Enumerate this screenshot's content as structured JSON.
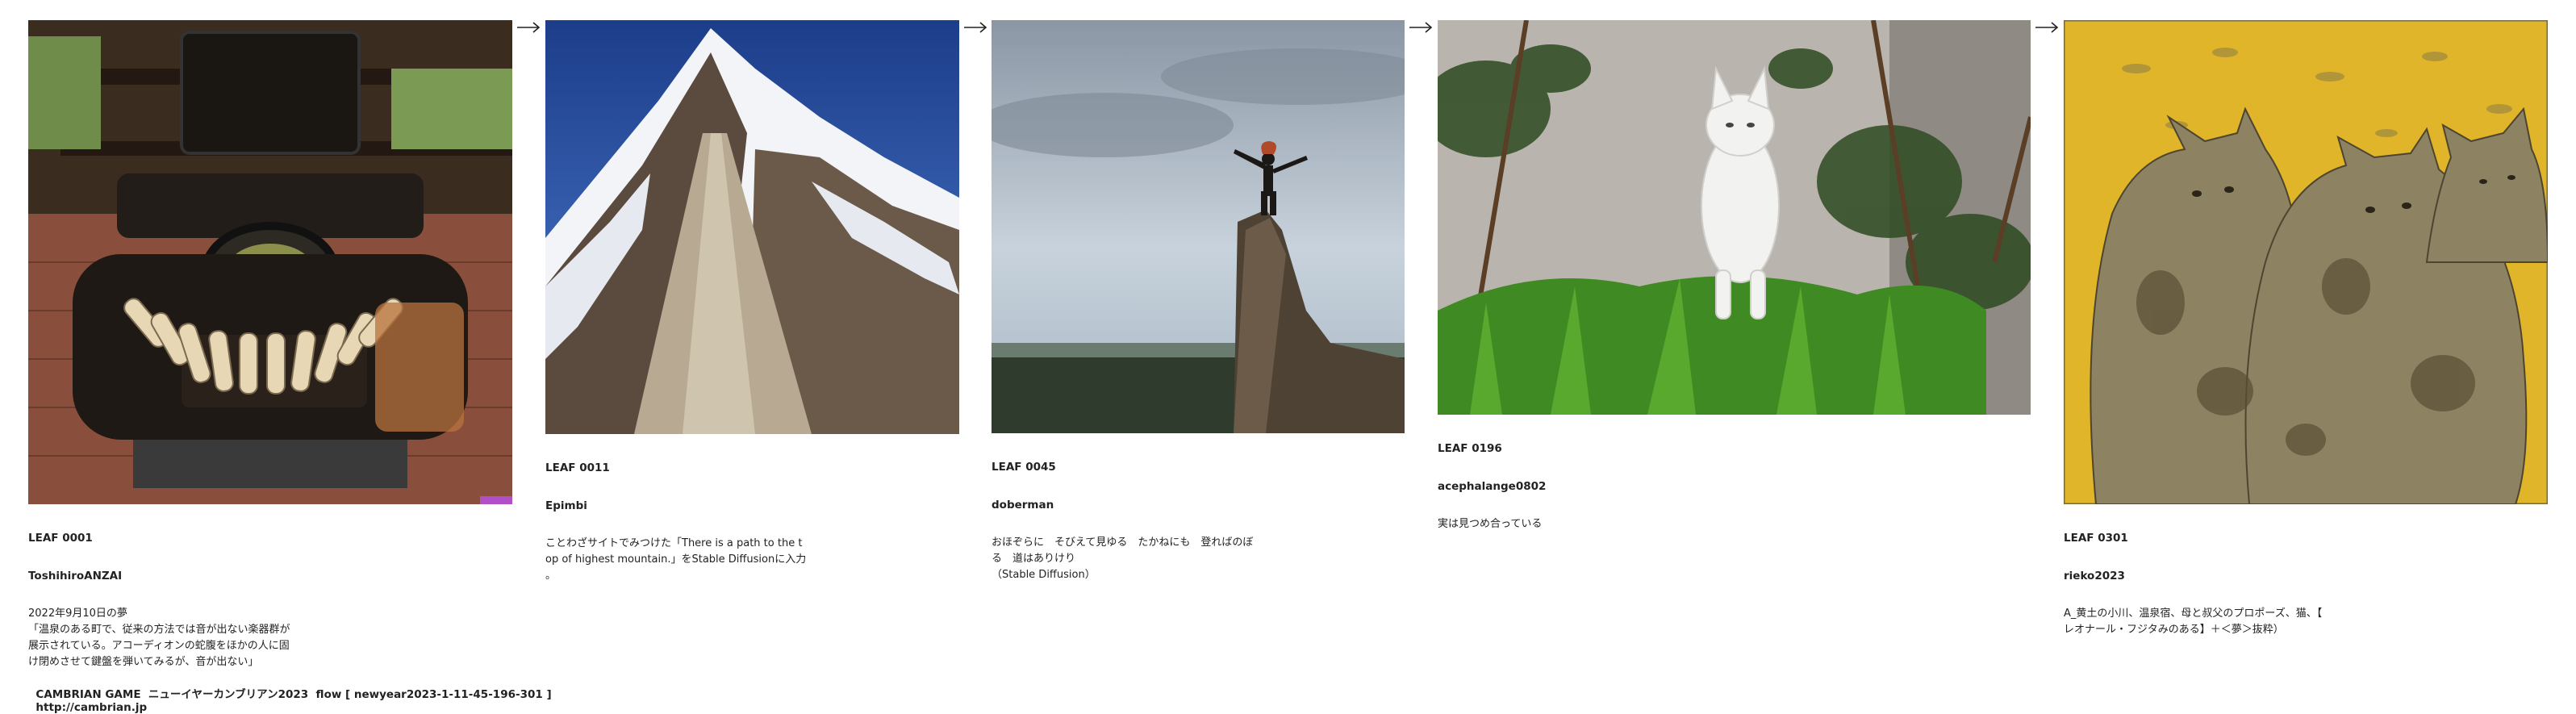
{
  "leaves": [
    {
      "code": "LEAF 0001",
      "author": "ToshihiroANZAI",
      "desc": "2022年9月10日の夢\n「温泉のある町で、従来の方法では音が出ない楽器群が\n展示されている。アコーディオンの蛇腹をほかの人に固\nけ閉めさせて鍵盤を弾いてみるが、音が出ない」"
    },
    {
      "code": "LEAF 0011",
      "author": "Epimbi",
      "desc": "ことわざサイトでみつけた「There is a path to the t\nop of highest mountain.」をStable Diffusionに入力\n。"
    },
    {
      "code": "LEAF 0045",
      "author": "doberman",
      "desc": "おほぞらに　そびえて見ゆる　たかねにも　登ればのぼ\nる　道はありけり\n（Stable Diffusion）"
    },
    {
      "code": "LEAF 0196",
      "author": "acephalange0802",
      "desc": "実は見つめ合っている"
    },
    {
      "code": "LEAF 0301",
      "author": "rieko2023",
      "desc": "A_黄土の小川、温泉宿、母と叔父のプロポーズ、猫、【\nレオナール・フジタみのある】＋＜夢＞抜粋）"
    }
  ],
  "footer": {
    "title": "CAMBRIAN GAME  ニューイヤーカンブリアン2023  flow [ newyear2023-1-11-45-196-301 ]",
    "url": "http://cambrian.jp"
  },
  "icons": [
    "arrow-right-icon"
  ]
}
